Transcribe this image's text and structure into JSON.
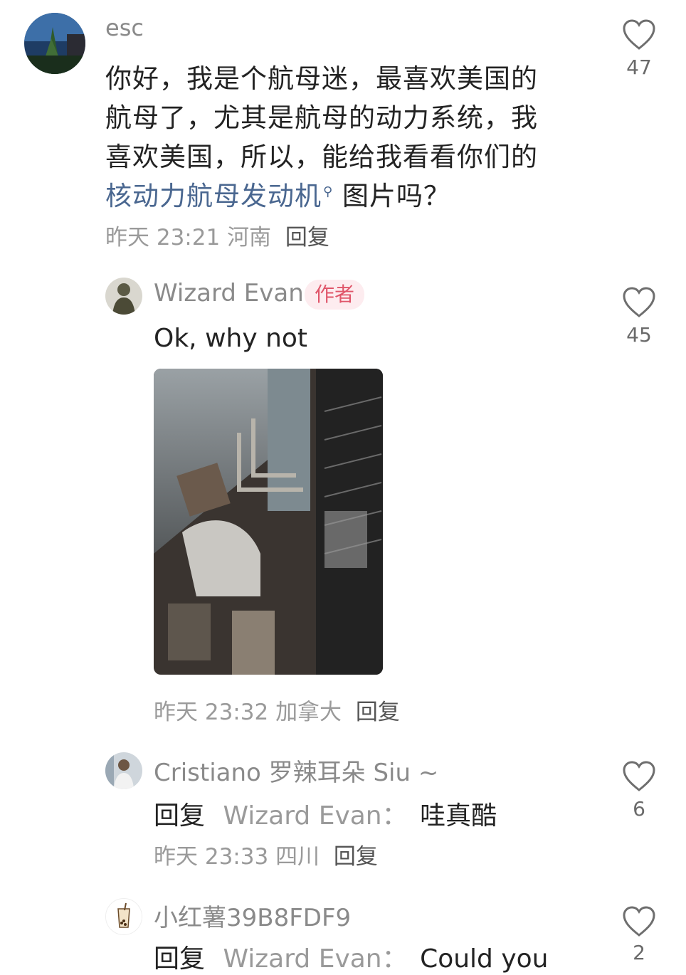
{
  "comments": [
    {
      "username": "esc",
      "text_lines": [
        "你好，我是个航母迷，最喜欢美国的",
        "航母了，尤其是航母的动力系统，我",
        "喜欢美国，所以，能给我看看你们的"
      ],
      "text_link": "核动力航母发动机",
      "text_after_link": " 图片吗？",
      "time": "昨天 23:21",
      "location": "河南",
      "reply_label": "回复",
      "likes": "47"
    },
    {
      "username": "Wizard Evan",
      "author_tag": "作者",
      "text": "Ok, why not",
      "time": "昨天 23:32",
      "location": "加拿大",
      "reply_label": "回复",
      "likes": "45"
    },
    {
      "username": "Cristiano 罗辣耳朵 Siu ~",
      "reply_prefix": "回复",
      "reply_to": "Wizard Evan：",
      "text": "哇真酷",
      "time": "昨天 23:33",
      "location": "四川",
      "reply_label": "回复",
      "likes": "6"
    },
    {
      "username": "小红薯39B8FDF9",
      "reply_prefix": "回复",
      "reply_to": "Wizard Evan：",
      "text": "Could you",
      "likes": "2"
    }
  ],
  "icons": {
    "like": "heart-icon",
    "search": "search-icon"
  },
  "colors": {
    "author_tag_bg": "#fdecef",
    "author_tag_text": "#e0566a",
    "link": "#4a6790"
  }
}
